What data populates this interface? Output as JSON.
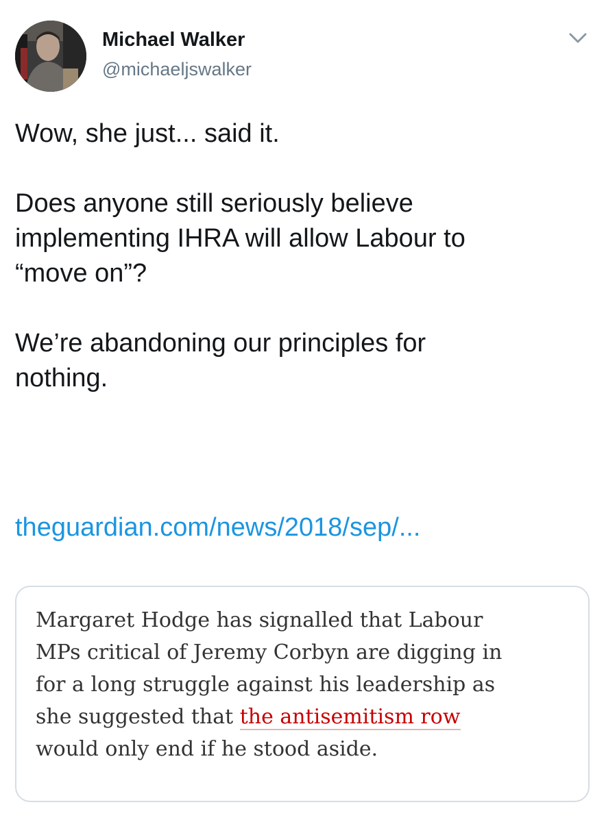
{
  "author": {
    "name": "Michael Walker",
    "handle": "@michaeljswalker"
  },
  "tweet": {
    "lines": [
      "Wow, she just... said it.",
      "Does anyone still seriously believe",
      "implementing IHRA will allow Labour to",
      "“move on”?",
      "We’re abandoning our principles for",
      "nothing."
    ],
    "link_text": "theguardian.com/news/2018/sep/..."
  },
  "card": {
    "line1": "Margaret Hodge has signalled that Labour",
    "line2": "MPs critical of Jeremy Corbyn are digging in",
    "line3": "for a long struggle against his leadership as",
    "line4_prefix": "she suggested that ",
    "line4_link": "the antisemitism row",
    "line5": "would only end if he stood aside."
  },
  "colors": {
    "link": "#1b95e0",
    "quote_link": "#c70000",
    "muted": "#657786",
    "text": "#14171a"
  },
  "icons": {
    "menu": "chevron-down-icon",
    "avatar": "avatar"
  }
}
